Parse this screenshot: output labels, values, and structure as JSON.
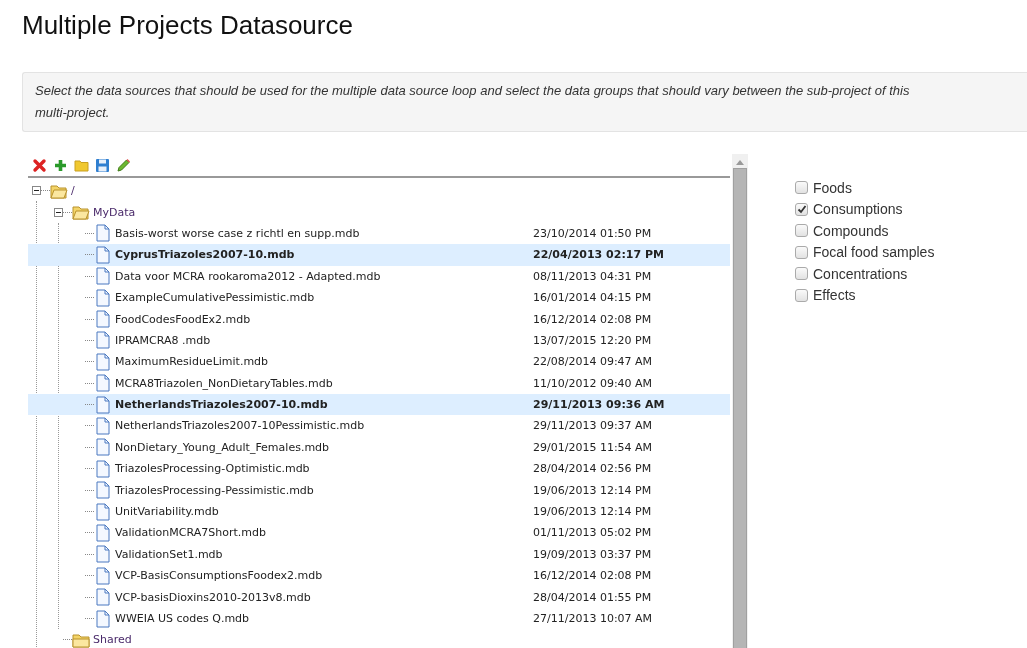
{
  "title": "Multiple Projects Datasource",
  "description": "Select the data sources that should be used for the multiple data source loop and select the data groups that should vary between the sub-project of this multi-project.",
  "tree": [
    {
      "kind": "folder",
      "label": "/",
      "expanded": true,
      "children": [
        {
          "kind": "folder",
          "label": "MyData",
          "expanded": true,
          "children": [
            {
              "kind": "file",
              "label": "Basis-worst worse case z richtl en supp.mdb",
              "date": "23/10/2014 01:50 PM",
              "selected": false
            },
            {
              "kind": "file",
              "label": "CyprusTriazoles2007-10.mdb",
              "date": "22/04/2013 02:17 PM",
              "selected": true
            },
            {
              "kind": "file",
              "label": "Data voor MCRA rookaroma2012 - Adapted.mdb",
              "date": "08/11/2013 04:31 PM",
              "selected": false
            },
            {
              "kind": "file",
              "label": "ExampleCumulativePessimistic.mdb",
              "date": "16/01/2014 04:15 PM",
              "selected": false
            },
            {
              "kind": "file",
              "label": "FoodCodesFoodEx2.mdb",
              "date": "16/12/2014 02:08 PM",
              "selected": false
            },
            {
              "kind": "file",
              "label": "IPRAMCRA8 .mdb",
              "date": "13/07/2015 12:20 PM",
              "selected": false
            },
            {
              "kind": "file",
              "label": "MaximumResidueLimit.mdb",
              "date": "22/08/2014 09:47 AM",
              "selected": false
            },
            {
              "kind": "file",
              "label": "MCRA8Triazolen_NonDietaryTables.mdb",
              "date": "11/10/2012 09:40 AM",
              "selected": false
            },
            {
              "kind": "file",
              "label": "NetherlandsTriazoles2007-10.mdb",
              "date": "29/11/2013 09:36 AM",
              "selected": true
            },
            {
              "kind": "file",
              "label": "NetherlandsTriazoles2007-10Pessimistic.mdb",
              "date": "29/11/2013 09:37 AM",
              "selected": false
            },
            {
              "kind": "file",
              "label": "NonDietary_Young_Adult_Females.mdb",
              "date": "29/01/2015 11:54 AM",
              "selected": false
            },
            {
              "kind": "file",
              "label": "TriazolesProcessing-Optimistic.mdb",
              "date": "28/04/2014 02:56 PM",
              "selected": false
            },
            {
              "kind": "file",
              "label": "TriazolesProcessing-Pessimistic.mdb",
              "date": "19/06/2013 12:14 PM",
              "selected": false
            },
            {
              "kind": "file",
              "label": "UnitVariability.mdb",
              "date": "19/06/2013 12:14 PM",
              "selected": false
            },
            {
              "kind": "file",
              "label": "ValidationMCRA7Short.mdb",
              "date": "01/11/2013 05:02 PM",
              "selected": false
            },
            {
              "kind": "file",
              "label": "ValidationSet1.mdb",
              "date": "19/09/2013 03:37 PM",
              "selected": false
            },
            {
              "kind": "file",
              "label": "VCP-BasisConsumptionsFoodex2.mdb",
              "date": "16/12/2014 02:08 PM",
              "selected": false
            },
            {
              "kind": "file",
              "label": "VCP-basisDioxins2010-2013v8.mdb",
              "date": "28/04/2014 01:55 PM",
              "selected": false
            },
            {
              "kind": "file",
              "label": "WWEIA US codes Q.mdb",
              "date": "27/11/2013 10:07 AM",
              "selected": false
            }
          ]
        },
        {
          "kind": "folder",
          "label": "Shared",
          "expanded": false
        }
      ]
    }
  ],
  "groups": [
    {
      "label": "Foods",
      "checked": false
    },
    {
      "label": "Consumptions",
      "checked": true
    },
    {
      "label": "Compounds",
      "checked": false
    },
    {
      "label": "Focal food samples",
      "checked": false
    },
    {
      "label": "Concentrations",
      "checked": false
    },
    {
      "label": "Effects",
      "checked": false
    }
  ]
}
